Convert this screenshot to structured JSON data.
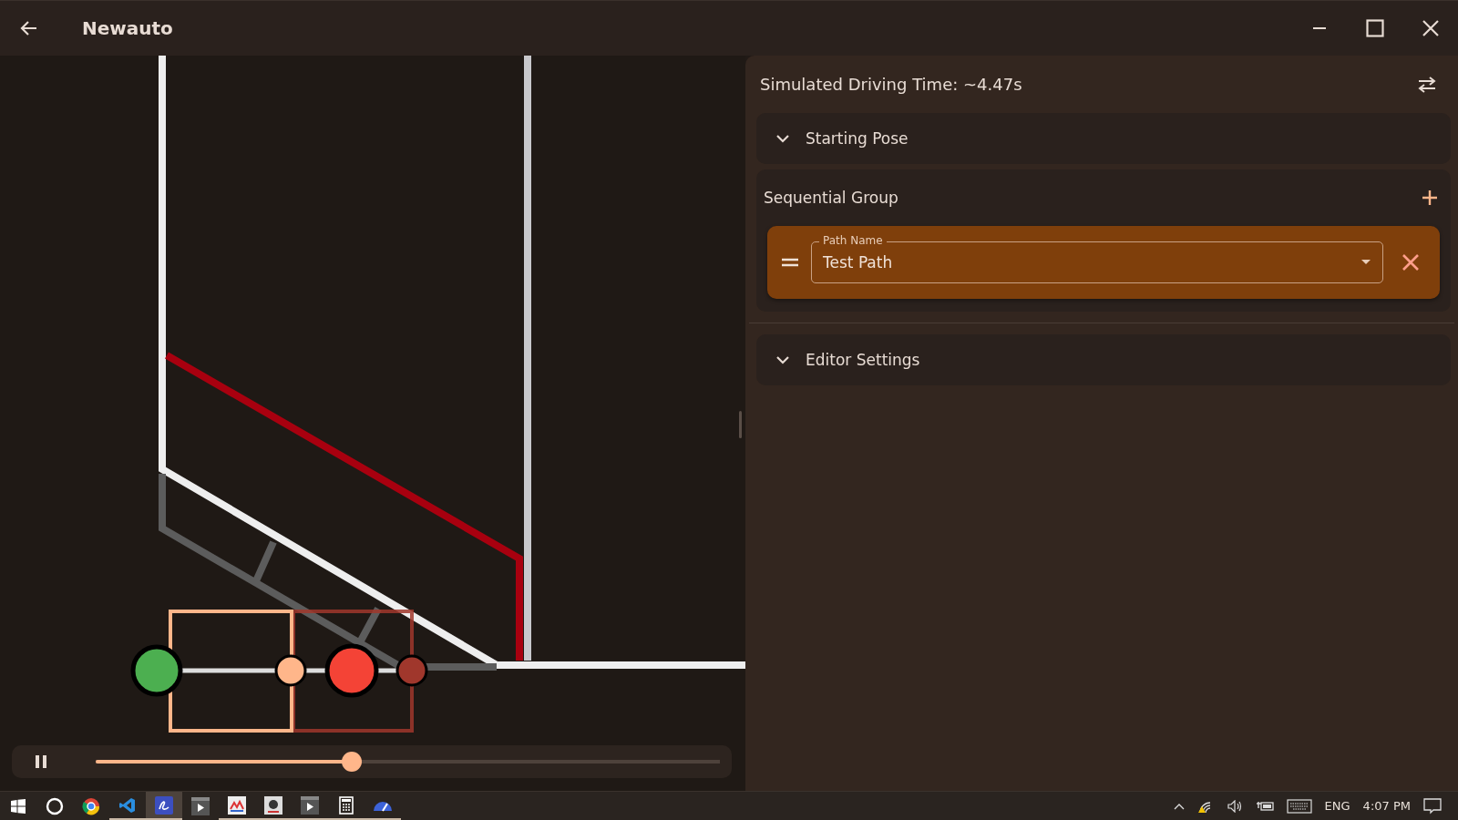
{
  "window": {
    "title": "Newauto"
  },
  "playback": {
    "playing": true,
    "level": 0.41
  },
  "sidebar": {
    "driving_time": "Simulated Driving Time: ~4.47s",
    "sections": [
      {
        "kind": "collapsible",
        "title": "Starting Pose",
        "expanded": false
      },
      {
        "kind": "group",
        "title": "Sequential Group",
        "commands": [
          {
            "label": "Path Name",
            "value": "Test Path"
          }
        ]
      },
      {
        "kind": "collapsible",
        "title": "Editor Settings",
        "expanded": false
      }
    ]
  },
  "taskbar": {
    "apps": [
      {
        "kind": "search",
        "open": false,
        "selected": false
      },
      {
        "kind": "browser",
        "open": false,
        "selected": false
      },
      {
        "kind": "code",
        "open": true,
        "selected": false
      },
      {
        "kind": "signature",
        "open": true,
        "selected": true
      },
      {
        "kind": "player",
        "open": false,
        "selected": false
      },
      {
        "kind": "chart",
        "open": true,
        "selected": false
      },
      {
        "kind": "java",
        "open": true,
        "selected": false
      },
      {
        "kind": "player",
        "open": true,
        "selected": false
      },
      {
        "kind": "calculator",
        "open": true,
        "selected": false
      },
      {
        "kind": "gauge",
        "open": true,
        "selected": false
      }
    ],
    "language": "ENG",
    "time": "4:07 PM"
  }
}
